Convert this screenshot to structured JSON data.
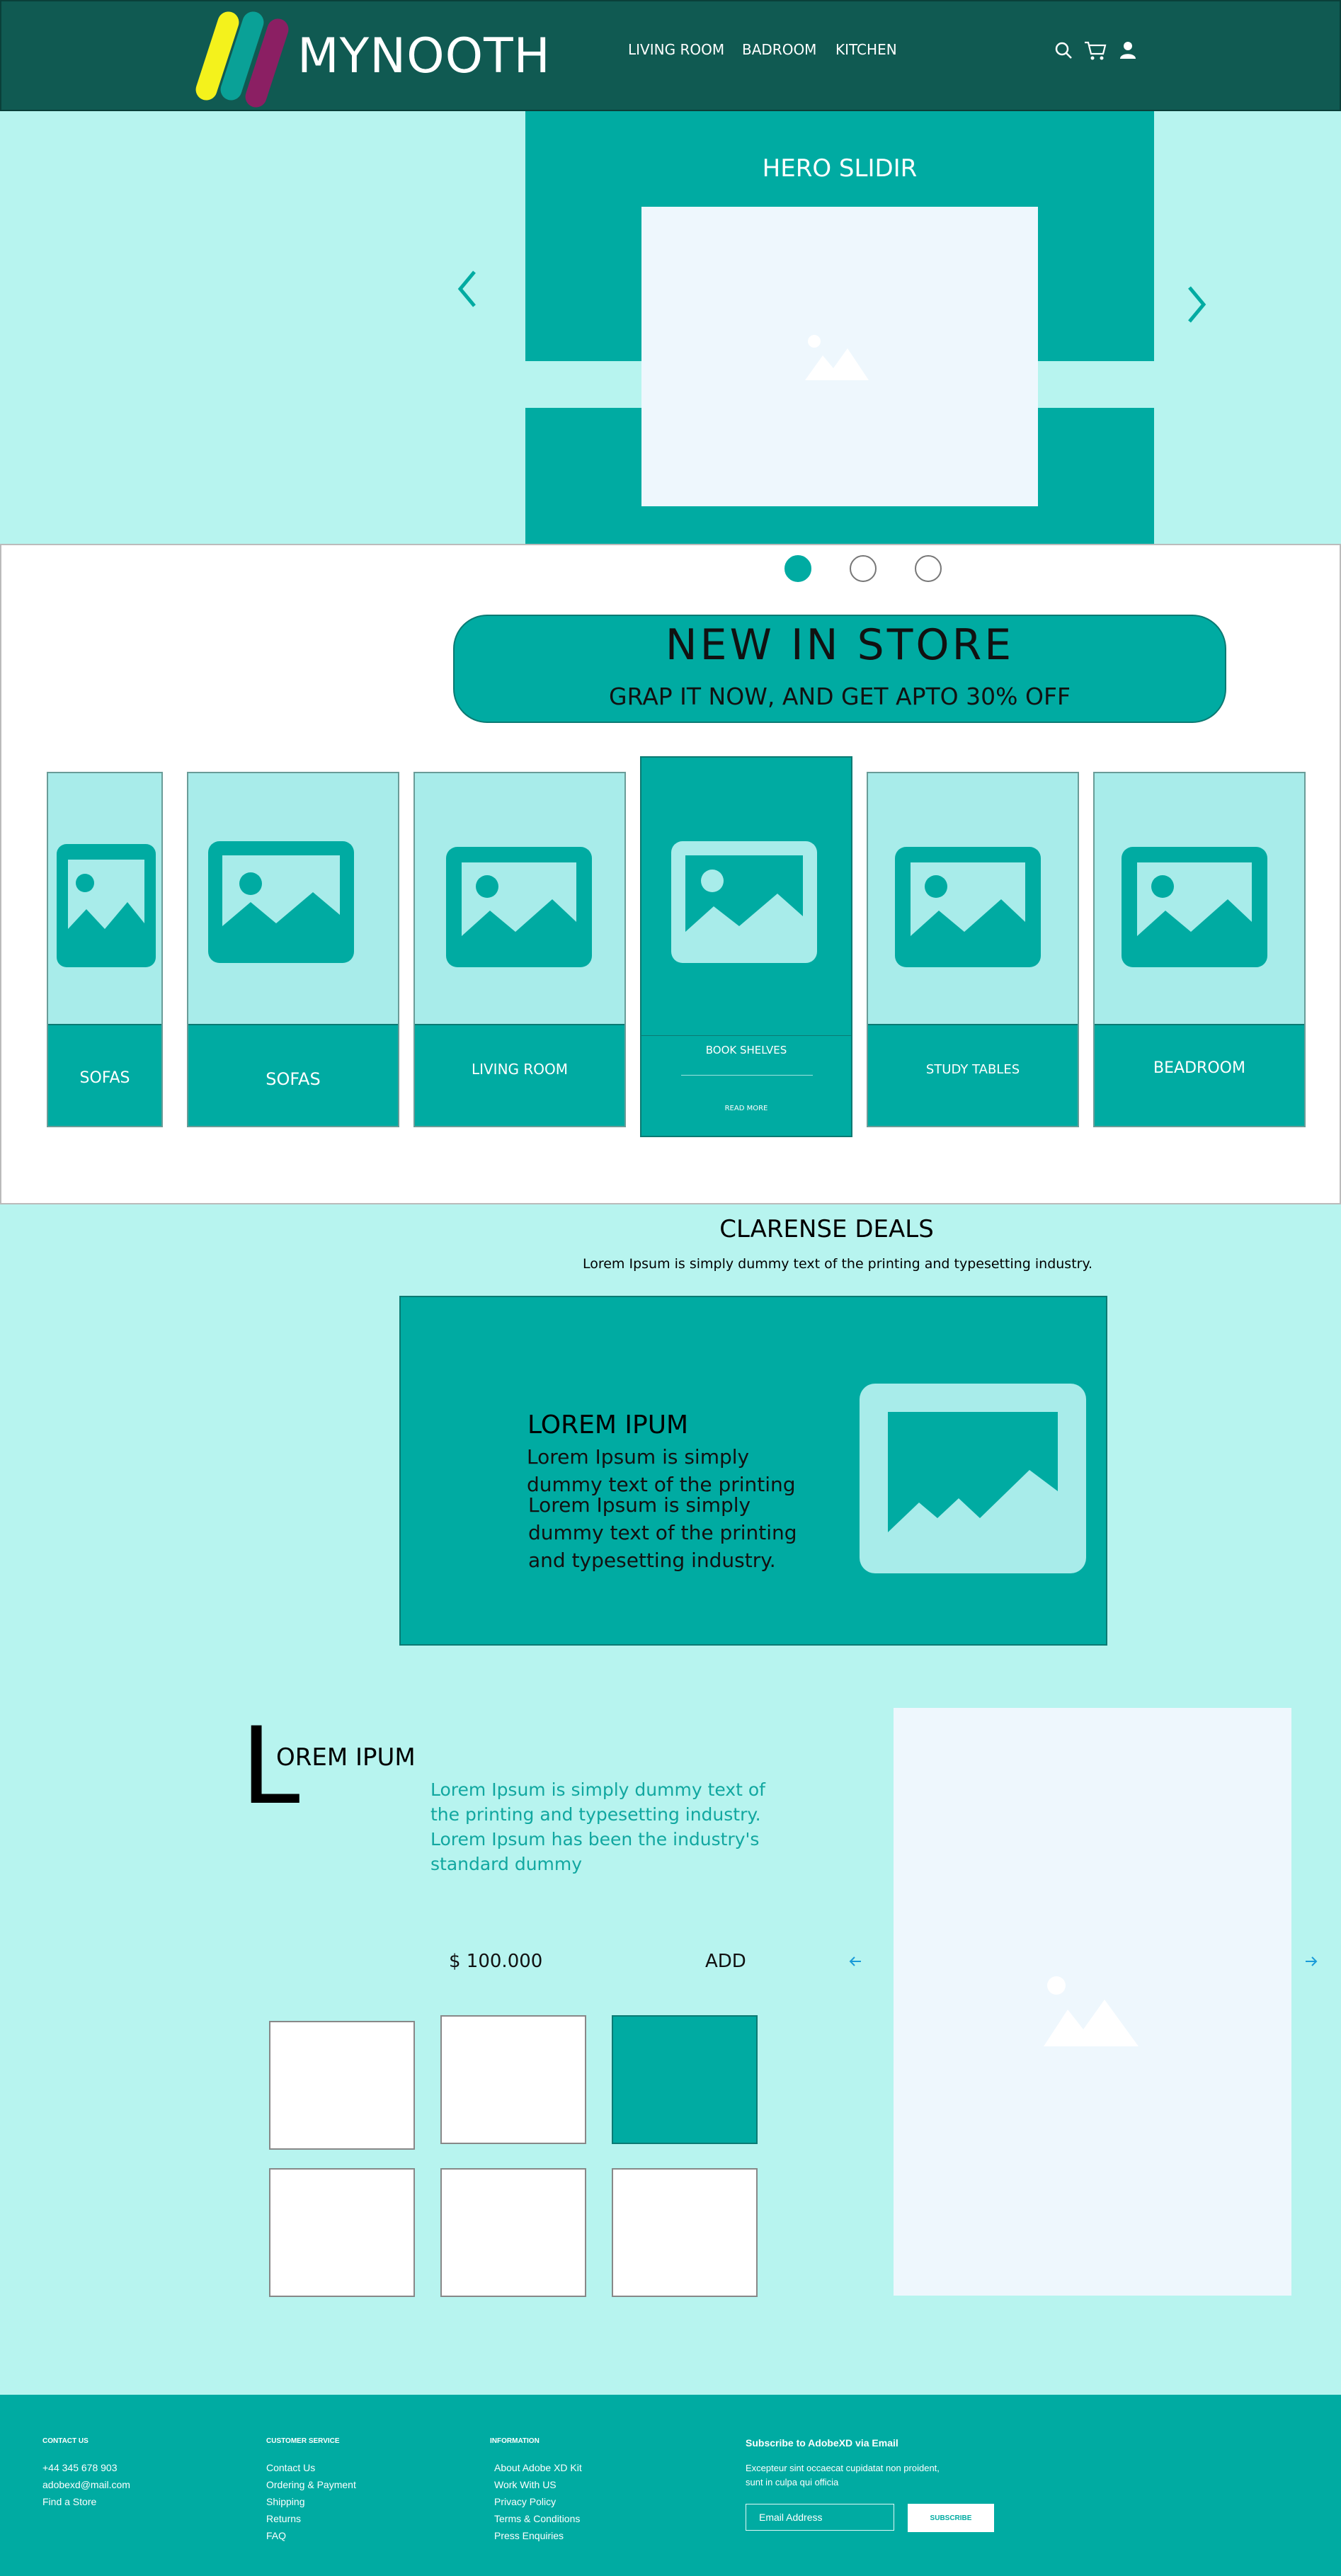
{
  "brand": {
    "name": "MYNOOTH",
    "logo_colors": [
      "#f4f21c",
      "#0aa197",
      "#8b1f63"
    ]
  },
  "header": {
    "nav": [
      "LIVING ROOM",
      "BADROOM",
      "KITCHEN"
    ],
    "icons": [
      "search-icon",
      "cart-icon",
      "user-icon"
    ]
  },
  "hero": {
    "title": "HERO SLIDIR",
    "slides_total": 3,
    "active_slide": 1
  },
  "promo": {
    "title": "NEW IN STORE",
    "subtitle": "GRAP IT NOW, AND GET APTO 30%  OFF"
  },
  "categories": [
    {
      "label": "SOFAS"
    },
    {
      "label": "SOFAS"
    },
    {
      "label": "LIVING ROOM"
    },
    {
      "label": "BOOK  SHELVES",
      "cta": "READ MORE",
      "active": true
    },
    {
      "label": "STUDY TABLES"
    },
    {
      "label": "BEADROOM"
    }
  ],
  "deals": {
    "title": "CLARENSE DEALS",
    "subtitle": "Lorem Ipsum is simply dummy text of the printing and typesetting industry.",
    "card": {
      "heading": "LOREM IPUM",
      "text_1": "Lorem Ipsum is simply dummy text of the printing",
      "text_2": "Lorem Ipsum is simply dummy text of the printing and typesetting industry."
    }
  },
  "product": {
    "big_letter": "L",
    "heading": "OREM IPUM",
    "description": "Lorem Ipsum is simply dummy text of the printing and typesetting industry. Lorem Ipsum has been the industry's standard dummy",
    "price": "$ 100.000",
    "add_label": "ADD",
    "thumbnails_active": 3
  },
  "footer": {
    "columns": [
      {
        "heading": "CONTACT US",
        "links": [
          "+44 345 678 903",
          "adobexd@mail.com",
          "Find a Store"
        ]
      },
      {
        "heading": "CUSTOMER SERVICE",
        "links": [
          "Contact Us",
          "Ordering & Payment",
          "Shipping",
          "Returns",
          "FAQ"
        ]
      },
      {
        "heading": "INFORMATION",
        "links": [
          "About Adobe XD Kit",
          "Work With US",
          "Privacy Policy",
          "Terms & Conditions",
          "Press Enquiries"
        ]
      }
    ],
    "subscribe": {
      "title": "Subscribe to AdobeXD via Email",
      "description": "Excepteur sint occaecat cupidatat non proident, sunt in culpa qui officia",
      "placeholder": "Email Address",
      "button": "SUBSCRIBE"
    }
  },
  "colors": {
    "header": "#105a52",
    "accent": "#00aba2",
    "background": "#b7f4ef",
    "light_panel": "#a8ecea"
  }
}
